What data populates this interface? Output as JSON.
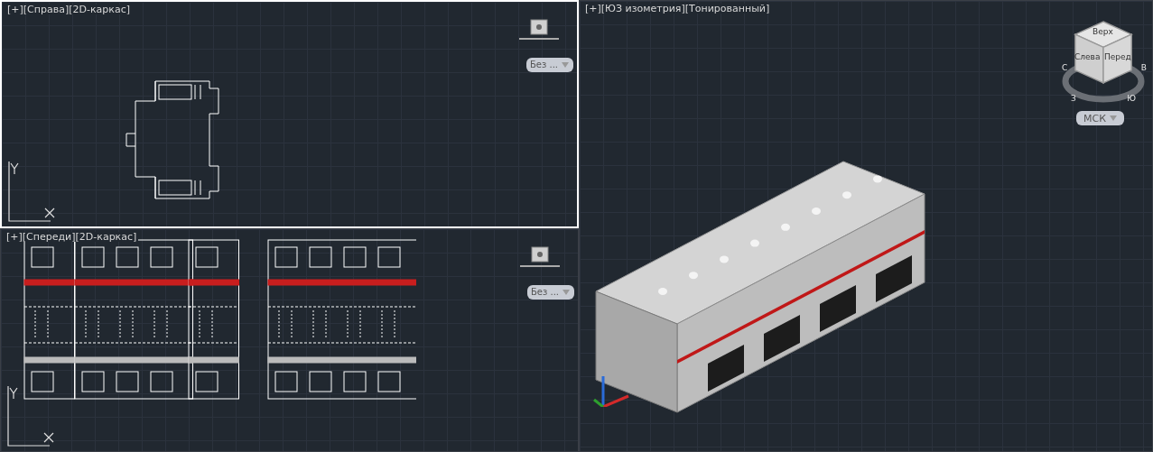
{
  "viewports": [
    {
      "kind": "side",
      "label": "[+][Справа][2D-каркас]",
      "active": true,
      "style_button": "Без ..."
    },
    {
      "kind": "front",
      "label": "[+][Спереди][2D-каркас]",
      "active": false,
      "style_button": "Без ..."
    },
    {
      "kind": "iso",
      "label": "[+][ЮЗ изометрия][Тонированный]",
      "active": false,
      "ucs_button": "МСК",
      "viewcube": {
        "faces": [
          "Верх",
          "Слева",
          "Перед"
        ],
        "compass": [
          "С",
          "В",
          "З",
          "Ю"
        ]
      }
    }
  ]
}
